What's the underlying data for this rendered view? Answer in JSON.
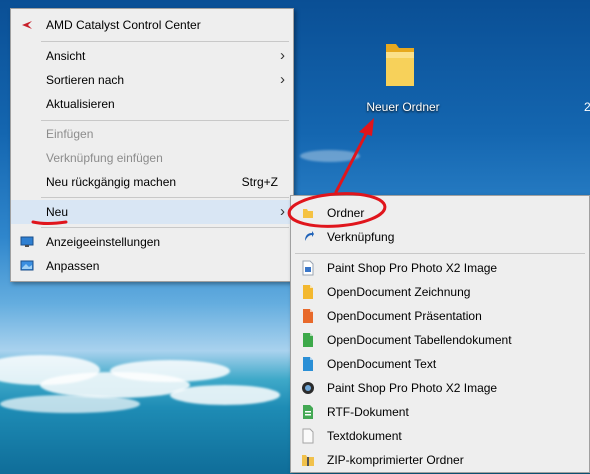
{
  "desktop": {
    "icon_label": "Neuer Ordner"
  },
  "context_menu": {
    "header": "AMD Catalyst Control Center",
    "view": "Ansicht",
    "sort_by": "Sortieren nach",
    "refresh": "Aktualisieren",
    "paste": "Einfügen",
    "paste_shortcut": "Verknüpfung einfügen",
    "undo": "Neu rückgängig machen",
    "undo_shortcut": "Strg+Z",
    "new": "Neu",
    "display_settings": "Anzeigeeinstellungen",
    "personalize": "Anpassen"
  },
  "submenu": {
    "folder": "Ordner",
    "shortcut": "Verknüpfung",
    "files": [
      "Paint Shop Pro Photo X2 Image",
      "OpenDocument Zeichnung",
      "OpenDocument Präsentation",
      "OpenDocument Tabellendokument",
      "OpenDocument Text",
      "Paint Shop Pro Photo X2 Image",
      "RTF-Dokument",
      "Textdokument",
      "ZIP-komprimierter Ordner"
    ]
  },
  "icons": [
    "amd-icon",
    "display-icon",
    "personalize-icon",
    "folder-icon",
    "shortcut-icon",
    "psp-icon",
    "odg-icon",
    "odp-icon",
    "ods-icon",
    "odt-icon",
    "camera-icon",
    "rtf-icon",
    "txt-icon",
    "zip-icon"
  ],
  "colors": {
    "menu_bg": "#eeeeee",
    "highlight": "#d9e6f4",
    "annotation_red": "#e0151c",
    "folder_yellow": "#f5c242"
  }
}
